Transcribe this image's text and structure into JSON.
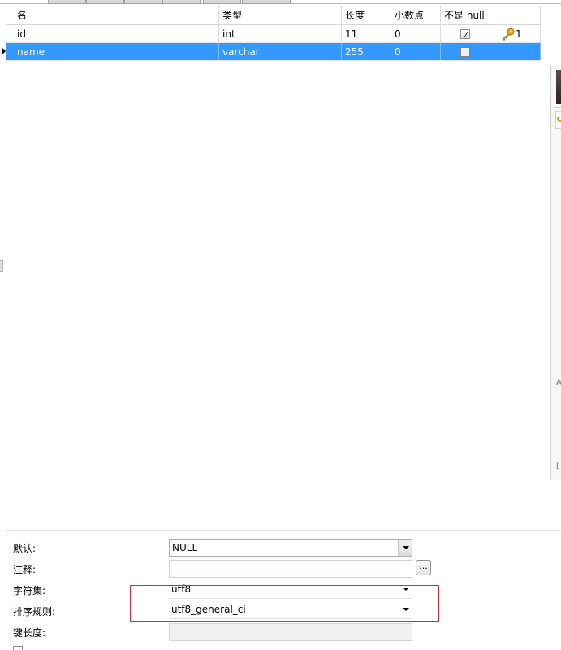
{
  "grid": {
    "columns": [
      "名",
      "类型",
      "长度",
      "小数点",
      "不是 null",
      ""
    ],
    "rows": [
      {
        "name": "id",
        "type": "int",
        "length": "11",
        "decimals": "0",
        "not_null": true,
        "key_index": "1",
        "selected": false
      },
      {
        "name": "name",
        "type": "varchar",
        "length": "255",
        "decimals": "0",
        "not_null": false,
        "key_index": "",
        "selected": true
      }
    ]
  },
  "properties": {
    "default_label": "默认:",
    "default_value": "NULL",
    "comment_label": "注释:",
    "comment_value": "",
    "ellipsis_label": "...",
    "charset_label": "字符集:",
    "charset_value": "utf8",
    "collation_label": "排序规则:",
    "collation_value": "utf8_general_ci",
    "key_length_label": "键长度:",
    "key_length_value": ""
  },
  "side_panel": {
    "glyph_a": "A",
    "glyph_b": "["
  },
  "colors": {
    "selection": "#3399ff",
    "highlight_box": "#e0262f",
    "key_icon": "#e8b020"
  },
  "icons": {
    "key": "key-icon",
    "row_marker": "row-indicator-icon",
    "dropdown": "chevron-down-icon"
  }
}
